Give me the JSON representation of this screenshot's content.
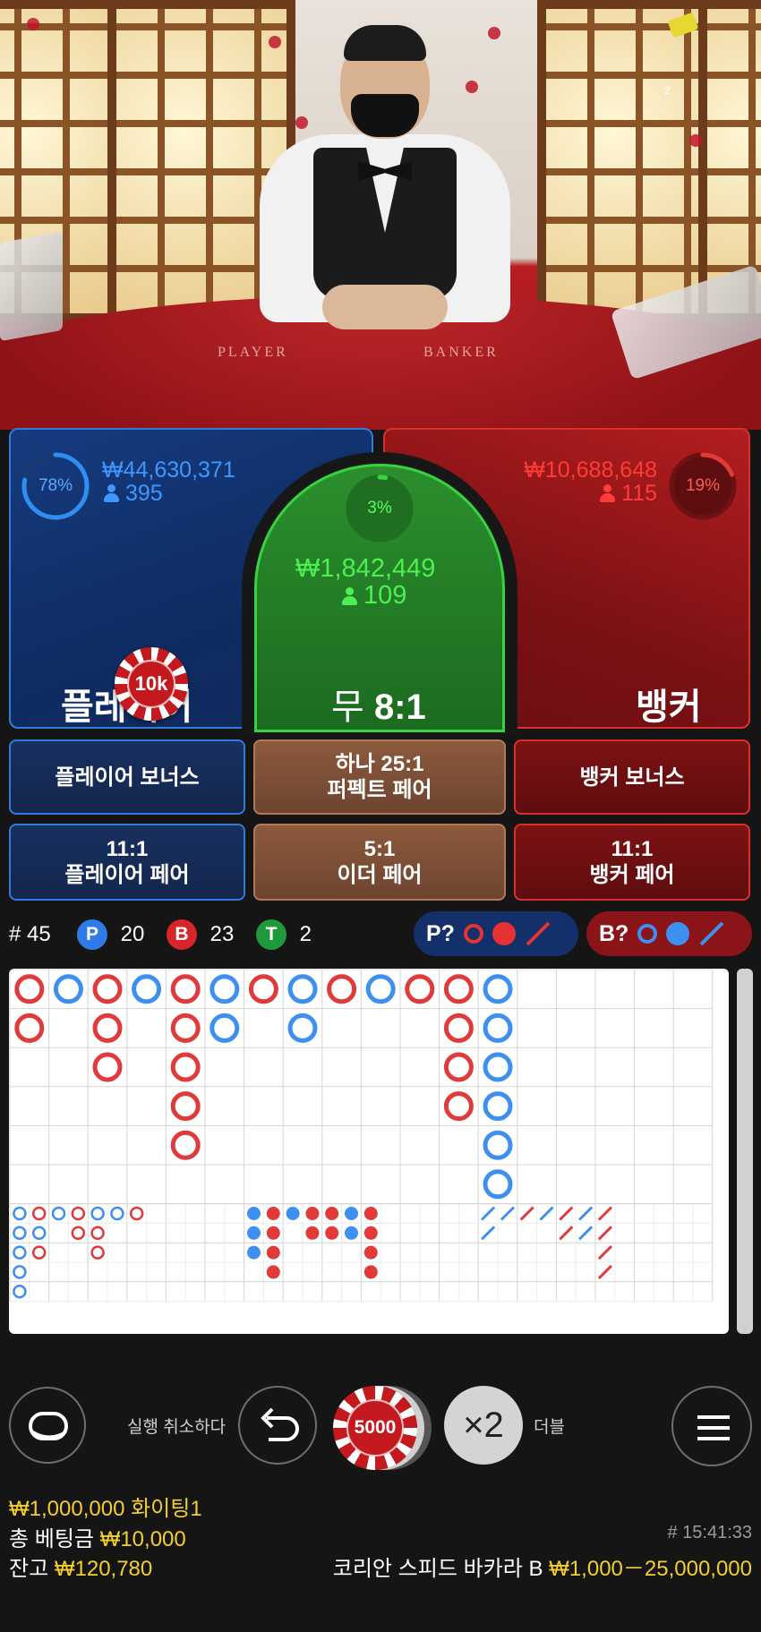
{
  "video": {
    "felt_player": "PLAYER",
    "felt_banker": "BANKER",
    "stream_number": "2"
  },
  "player": {
    "percent": "78%",
    "percent_value": 78,
    "amount": "₩44,630,371",
    "count": "395",
    "label": "플레이어",
    "chip": "10k",
    "color": "#2f8ff0"
  },
  "tie": {
    "percent": "3%",
    "percent_value": 3,
    "amount": "₩1,842,449",
    "count": "109",
    "label": "무",
    "payout": "8:1",
    "color": "#3bd43f"
  },
  "banker": {
    "percent": "19%",
    "percent_value": 19,
    "amount": "₩10,688,648",
    "count": "115",
    "label": "뱅커",
    "color": "#e33a36"
  },
  "side_bets": {
    "player_bonus": "플레이어 보너스",
    "perfect_pair_line1": "하나 25:1",
    "perfect_pair_line2": "퍼펙트 페어",
    "banker_bonus": "뱅커 보너스",
    "player_pair_line1": "11:1",
    "player_pair_line2": "플레이어 페어",
    "either_pair_line1": "5:1",
    "either_pair_line2": "이더 페어",
    "banker_pair_line1": "11:1",
    "banker_pair_line2": "뱅커 페어"
  },
  "stats": {
    "round": "# 45",
    "p_badge": "P",
    "p_count": "20",
    "b_badge": "B",
    "b_count": "23",
    "t_badge": "T",
    "t_count": "2",
    "p_predict": "P?",
    "b_predict": "B?"
  },
  "roads": {
    "bead_columns": [
      [
        "B",
        "B"
      ],
      [
        "P"
      ],
      [
        "B",
        "B",
        "B"
      ],
      [
        "P"
      ],
      [
        "B",
        "B",
        "B",
        "B",
        "B"
      ],
      [
        "P",
        "P"
      ],
      [
        "B"
      ],
      [
        "P",
        "P"
      ],
      [
        "B"
      ],
      [
        "P"
      ],
      [
        "B"
      ],
      [
        "B",
        "B",
        "B",
        "B"
      ],
      [
        "P",
        "P",
        "P",
        "P",
        "P",
        "P"
      ]
    ],
    "big_eye": [
      [
        "P",
        "P",
        "P",
        "P",
        "P"
      ],
      [
        "B",
        "P",
        "B"
      ],
      [
        "P"
      ],
      [
        "B",
        "B"
      ],
      [
        "P",
        "B",
        "B"
      ],
      [
        "P"
      ],
      [
        "B"
      ]
    ],
    "small": [
      [
        "P",
        "P",
        "P"
      ],
      [
        "B",
        "B",
        "B",
        "B"
      ],
      [
        "P"
      ],
      [
        "B",
        "B"
      ],
      [
        "B",
        "B"
      ],
      [
        "P",
        "P"
      ],
      [
        "B",
        "B",
        "B",
        "B"
      ]
    ],
    "cockroach": [
      [
        "P",
        "P"
      ],
      [
        "P"
      ],
      [
        "B"
      ],
      [
        "P"
      ],
      [
        "B",
        "B"
      ],
      [
        "P",
        "P"
      ],
      [
        "B",
        "B",
        "B",
        "B"
      ]
    ]
  },
  "controls": {
    "undo_label": "실행 취소하다",
    "chip_value": "5000",
    "double_symbol": "×2",
    "double_label": "더블"
  },
  "footer": {
    "bet_limit": "₩1,000,000 화이팅1",
    "total_bet_label": "총 베팅금",
    "total_bet": "₩10,000",
    "balance_label": "잔고",
    "balance": "₩120,780",
    "time": "# 15:41:33",
    "table_name": "코리안 스피드 바카라 B",
    "table_limits": "₩1,000－25,000,000"
  }
}
